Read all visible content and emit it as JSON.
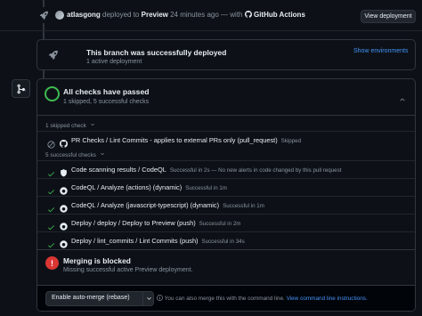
{
  "deploy_event": {
    "user": "atlasgong",
    "action": "deployed to",
    "environment": "Preview",
    "time_ago": "24 minutes ago",
    "separator": "— with",
    "actor": "GitHub Actions",
    "view_button_label": "View deployment"
  },
  "deployment": {
    "title": "This branch was successfully deployed",
    "subtitle": "1 active deployment",
    "show_env_label": "Show environments"
  },
  "checks": {
    "title": "All checks have passed",
    "subtitle": "1 skipped, 5 successful checks",
    "skipped_group_label": "1 skipped check",
    "success_group_label": "5 successful checks",
    "skipped": [
      {
        "name": "PR Checks / Lint Commits - applies to external PRs only (pull_request)",
        "detail": "Skipped"
      }
    ],
    "successful": [
      {
        "name": "Code scanning results / CodeQL",
        "detail": "Successful in 2s — No new alerts in code changed by this pull request"
      },
      {
        "name": "CodeQL / Analyze (actions) (dynamic)",
        "detail": "Successful in 1m"
      },
      {
        "name": "CodeQL / Analyze (javascript-typescript) (dynamic)",
        "detail": "Successful in 1m"
      },
      {
        "name": "Deploy / deploy / Deploy to Preview (push)",
        "detail": "Successful in 2m"
      },
      {
        "name": "Deploy / lint_commits / Lint Commits (push)",
        "detail": "Successful in 34s"
      }
    ]
  },
  "merge": {
    "title": "Merging is blocked",
    "subtitle": "Missing successful active Preview deployment.",
    "auto_merge_label": "Enable auto-merge (rebase)",
    "footer_text": "You can also merge this with the command line.",
    "footer_link": "View command line instructions."
  },
  "colors": {
    "background": "#0d1117",
    "success_green": "#3fb950",
    "danger_red": "#da3633",
    "link_blue": "#4493f8",
    "muted": "#8b949e"
  }
}
